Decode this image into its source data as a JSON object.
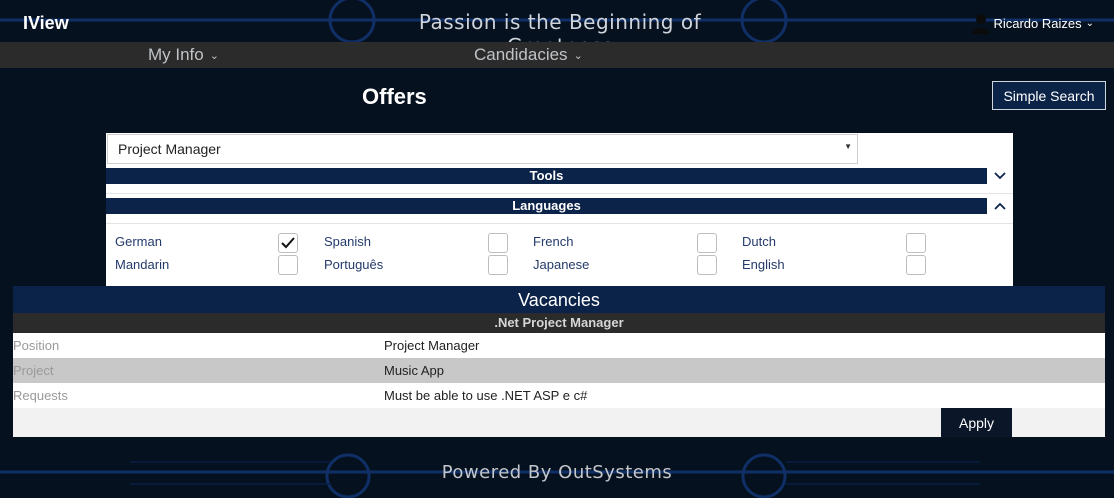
{
  "header": {
    "logo": "IView",
    "tagline": "Passion is the Beginning of Greatness",
    "user_name": "Ricardo Raizes"
  },
  "nav": {
    "items": [
      {
        "label": "My Info"
      },
      {
        "label": "Candidacies"
      }
    ]
  },
  "main": {
    "title": "Offers",
    "simple_search_label": "Simple Search"
  },
  "filters": {
    "position_select": "Project Manager",
    "tools_label": "Tools",
    "languages_label": "Languages",
    "languages": [
      {
        "label": "German",
        "checked": true
      },
      {
        "label": "Spanish",
        "checked": false
      },
      {
        "label": "French",
        "checked": false
      },
      {
        "label": "Dutch",
        "checked": false
      },
      {
        "label": "Mandarin",
        "checked": false
      },
      {
        "label": "Português",
        "checked": false
      },
      {
        "label": "Japanese",
        "checked": false
      },
      {
        "label": "English",
        "checked": false
      }
    ]
  },
  "vacancies": {
    "title": "Vacancies",
    "offer_name": ".Net Project Manager",
    "rows": [
      {
        "label": "Position",
        "value": "Project Manager"
      },
      {
        "label": "Project",
        "value": "Music App"
      },
      {
        "label": "Requests",
        "value": "Must be able to use .NET ASP e c#"
      }
    ],
    "apply_label": "Apply"
  },
  "footer": {
    "text": "Powered By OutSystems"
  },
  "colors": {
    "background": "#06111f",
    "accent_navy": "#0c2349",
    "nav_bar": "#2b2b2b",
    "circuit": "#0f2f66"
  }
}
